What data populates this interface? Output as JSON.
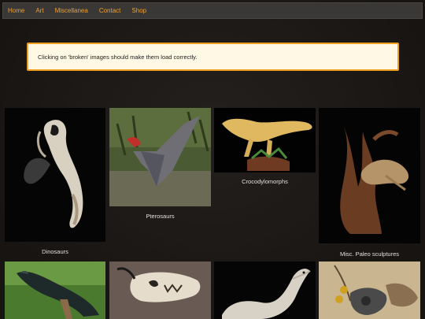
{
  "nav": {
    "items": [
      {
        "label": "Home"
      },
      {
        "label": "Art"
      },
      {
        "label": "Miscellanea"
      },
      {
        "label": "Contact"
      },
      {
        "label": "Shop"
      }
    ]
  },
  "notice": {
    "text": "Clicking on 'broken' images should make them load correctly."
  },
  "gallery": {
    "items": [
      {
        "caption": "Dinosaurs",
        "subject": "dinosaur-skull-sculpture"
      },
      {
        "caption": "Pterosaurs",
        "subject": "pterosaur-sculpture"
      },
      {
        "caption": "Crocodylomorphs",
        "subject": "crocodylomorph-sculpture"
      },
      {
        "caption": "Misc. Paleo sculptures",
        "subject": "ray-driftwood-sculpture"
      },
      {
        "caption": "",
        "subject": "lizard-sculpture"
      },
      {
        "caption": "",
        "subject": "skull-sculpture"
      },
      {
        "caption": "",
        "subject": "feathered-dinosaur-sculpture"
      },
      {
        "caption": "",
        "subject": "feather-pendant"
      }
    ]
  },
  "colors": {
    "nav_link": "#f0a030",
    "notice_border": "#f0a020",
    "notice_bg": "#fff8e4"
  }
}
